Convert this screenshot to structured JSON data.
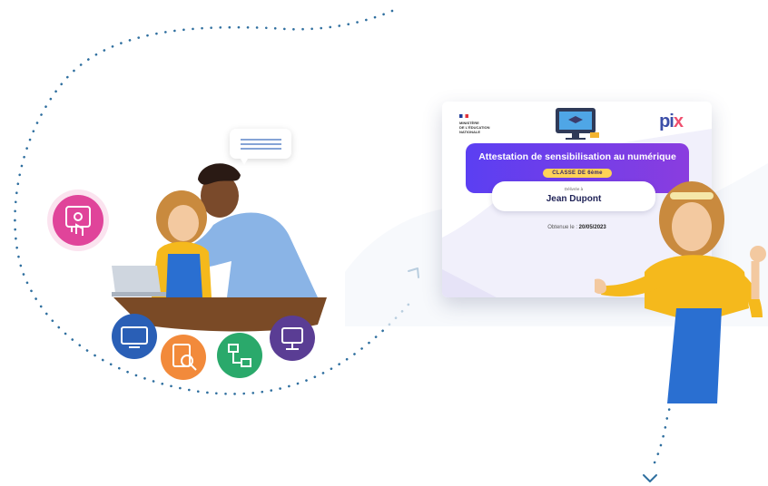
{
  "certificate": {
    "ministry_lines": [
      "MINISTÈRE",
      "DE L'ÉDUCATION",
      "NATIONALE"
    ],
    "logo_text": "pi",
    "logo_accent": "x",
    "title": "Attestation de sensibilisation au numérique",
    "classe": "CLASSE DE 6ème",
    "awarded_label": "Délivrée à",
    "recipient": "Jean Dupont",
    "obtained_label": "Obtenue le :",
    "obtained_date": "20/05/2023"
  },
  "colors": {
    "dots": "#2f6f9f",
    "banner_start": "#5b3ff2",
    "banner_end": "#8a3ddf",
    "badge": "#ffd257",
    "pink_icon": "#e0449a",
    "blue_icon": "#2a5fb6",
    "orange_icon": "#f28a3b",
    "green_icon": "#2aa96b",
    "purple_icon": "#5a3d94"
  },
  "icons": [
    "secure-access-icon",
    "computer-repair-icon",
    "search-document-icon",
    "network-icon",
    "computer-network-icon"
  ]
}
